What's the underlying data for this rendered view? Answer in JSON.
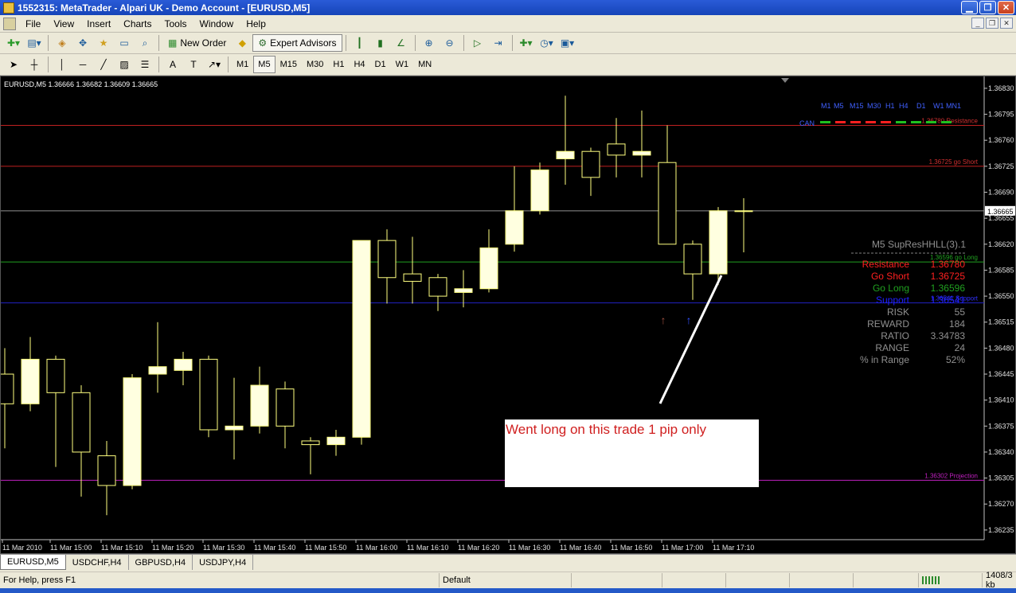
{
  "window": {
    "title": "1552315: MetaTrader - Alpari UK - Demo Account - [EURUSD,M5]"
  },
  "menu": {
    "items": [
      "File",
      "View",
      "Insert",
      "Charts",
      "Tools",
      "Window",
      "Help"
    ]
  },
  "toolbar": {
    "new_order_label": "New Order",
    "expert_advisors_label": "Expert Advisors",
    "timeframes": [
      "M1",
      "M5",
      "M15",
      "M30",
      "H1",
      "H4",
      "D1",
      "W1",
      "MN"
    ],
    "active_timeframe": "M5"
  },
  "chart": {
    "header": "EURUSD,M5  1.36666 1.36682 1.36609 1.36665",
    "current_price_label": "1.36665",
    "note_text": "Went long on this trade 1 pip only",
    "panel_title": "M5 SupResHHLL(3).1",
    "panel_rows": [
      {
        "label": "Resistance",
        "value": "1.36780",
        "color": "#ff2020"
      },
      {
        "label": "Go Short",
        "value": "1.36725",
        "color": "#ff2020"
      },
      {
        "label": "Go Long",
        "value": "1.36596",
        "color": "#20a020"
      },
      {
        "label": "Support",
        "value": "1.36541",
        "color": "#2020ff"
      },
      {
        "label": "RISK",
        "value": "55",
        "color": "#909090"
      },
      {
        "label": "REWARD",
        "value": "184",
        "color": "#909090"
      },
      {
        "label": "RATIO",
        "value": "3.34783",
        "color": "#909090"
      },
      {
        "label": "RANGE",
        "value": "24",
        "color": "#909090"
      },
      {
        "label": "% in Range",
        "value": "52%",
        "color": "#909090"
      }
    ],
    "tf_legend": {
      "labels": [
        "M1",
        "M5",
        "M15",
        "M30",
        "H1",
        "H4",
        "D1",
        "W1",
        "MN1"
      ],
      "row_label": "CAN",
      "dash_colors": [
        "#20c020",
        "#ff2020",
        "#ff2020",
        "#ff2020",
        "#ff2020",
        "#20c020",
        "#20c020",
        "#20c020",
        "#20c020"
      ]
    },
    "level_labels": [
      {
        "text": "1.36780 Resistance",
        "price": 1.3678,
        "color": "#d03030"
      },
      {
        "text": "1.36725 go Short",
        "price": 1.36725,
        "color": "#d03030"
      },
      {
        "text": "1.36596 go Long",
        "price": 1.36596,
        "color": "#20a020"
      },
      {
        "text": "1.36541 Support",
        "price": 1.36541,
        "color": "#3030ff"
      },
      {
        "text": "1.36302 Projection",
        "price": 1.36302,
        "color": "#c020c0"
      }
    ],
    "colors": {
      "background": "#000000",
      "bull_fill": "#ffffe0",
      "candle_outline": "#ffff80",
      "resistance": "#c02020",
      "support": "#2020c0",
      "golong": "#20a020",
      "projection": "#c020c0",
      "current": "#909090"
    }
  },
  "chart_data": {
    "type": "candlestick",
    "symbol": "EURUSD",
    "timeframe": "M5",
    "y_ticks": [
      "1.36830",
      "1.36795",
      "1.36760",
      "1.36725",
      "1.36690",
      "1.36655",
      "1.36620",
      "1.36585",
      "1.36550",
      "1.36515",
      "1.36480",
      "1.36445",
      "1.36410",
      "1.36375",
      "1.36340",
      "1.36305",
      "1.36270",
      "1.36235"
    ],
    "ylim": [
      1.36222,
      1.36846
    ],
    "x_ticks": [
      "11 Mar 2010",
      "11 Mar 15:00",
      "11 Mar 15:10",
      "11 Mar 15:20",
      "11 Mar 15:30",
      "11 Mar 15:40",
      "11 Mar 15:50",
      "11 Mar 16:00",
      "11 Mar 16:10",
      "11 Mar 16:20",
      "11 Mar 16:30",
      "11 Mar 16:40",
      "11 Mar 16:50",
      "11 Mar 17:00",
      "11 Mar 17:10"
    ],
    "candles": [
      {
        "o": 1.36445,
        "h": 1.3648,
        "l": 1.36345,
        "c": 1.36405
      },
      {
        "o": 1.36405,
        "h": 1.36495,
        "l": 1.36395,
        "c": 1.36465
      },
      {
        "o": 1.36465,
        "h": 1.3647,
        "l": 1.3632,
        "c": 1.3642
      },
      {
        "o": 1.3642,
        "h": 1.3643,
        "l": 1.3628,
        "c": 1.3634
      },
      {
        "o": 1.36335,
        "h": 1.36355,
        "l": 1.36255,
        "c": 1.36295
      },
      {
        "o": 1.36295,
        "h": 1.36445,
        "l": 1.3629,
        "c": 1.3644
      },
      {
        "o": 1.36445,
        "h": 1.36515,
        "l": 1.3642,
        "c": 1.36455
      },
      {
        "o": 1.3645,
        "h": 1.36475,
        "l": 1.3643,
        "c": 1.36465
      },
      {
        "o": 1.36465,
        "h": 1.3647,
        "l": 1.3636,
        "c": 1.3637
      },
      {
        "o": 1.3637,
        "h": 1.3644,
        "l": 1.3633,
        "c": 1.36375
      },
      {
        "o": 1.36375,
        "h": 1.36455,
        "l": 1.36365,
        "c": 1.3643
      },
      {
        "o": 1.36425,
        "h": 1.36435,
        "l": 1.36345,
        "c": 1.36375
      },
      {
        "o": 1.36355,
        "h": 1.3636,
        "l": 1.3631,
        "c": 1.3635
      },
      {
        "o": 1.3635,
        "h": 1.3637,
        "l": 1.36335,
        "c": 1.3636
      },
      {
        "o": 1.3636,
        "h": 1.36435,
        "l": 1.3635,
        "c": 1.36625
      },
      {
        "o": 1.36625,
        "h": 1.3664,
        "l": 1.3654,
        "c": 1.36575
      },
      {
        "o": 1.3658,
        "h": 1.3663,
        "l": 1.3654,
        "c": 1.3657
      },
      {
        "o": 1.36575,
        "h": 1.3658,
        "l": 1.3653,
        "c": 1.3655
      },
      {
        "o": 1.36555,
        "h": 1.36585,
        "l": 1.36535,
        "c": 1.3656
      },
      {
        "o": 1.3656,
        "h": 1.3664,
        "l": 1.36555,
        "c": 1.36615
      },
      {
        "o": 1.3662,
        "h": 1.36725,
        "l": 1.3661,
        "c": 1.36665
      },
      {
        "o": 1.36665,
        "h": 1.3673,
        "l": 1.3666,
        "c": 1.3672
      },
      {
        "o": 1.36735,
        "h": 1.3682,
        "l": 1.367,
        "c": 1.36745
      },
      {
        "o": 1.36745,
        "h": 1.3675,
        "l": 1.36685,
        "c": 1.3671
      },
      {
        "o": 1.36755,
        "h": 1.3679,
        "l": 1.3671,
        "c": 1.3674
      },
      {
        "o": 1.3674,
        "h": 1.368,
        "l": 1.3671,
        "c": 1.36745
      },
      {
        "o": 1.3673,
        "h": 1.3678,
        "l": 1.3662,
        "c": 1.3662
      },
      {
        "o": 1.3662,
        "h": 1.36625,
        "l": 1.36545,
        "c": 1.3658
      },
      {
        "o": 1.3658,
        "h": 1.3667,
        "l": 1.36565,
        "c": 1.36665
      },
      {
        "o": 1.36665,
        "h": 1.36682,
        "l": 1.36609,
        "c": 1.36665
      }
    ]
  },
  "tabs": {
    "items": [
      "EURUSD,M5",
      "USDCHF,H4",
      "GBPUSD,H4",
      "USDJPY,H4"
    ],
    "active": 0
  },
  "status": {
    "help": "For Help, press F1",
    "profile": "Default",
    "traffic": "1408/3 kb"
  }
}
